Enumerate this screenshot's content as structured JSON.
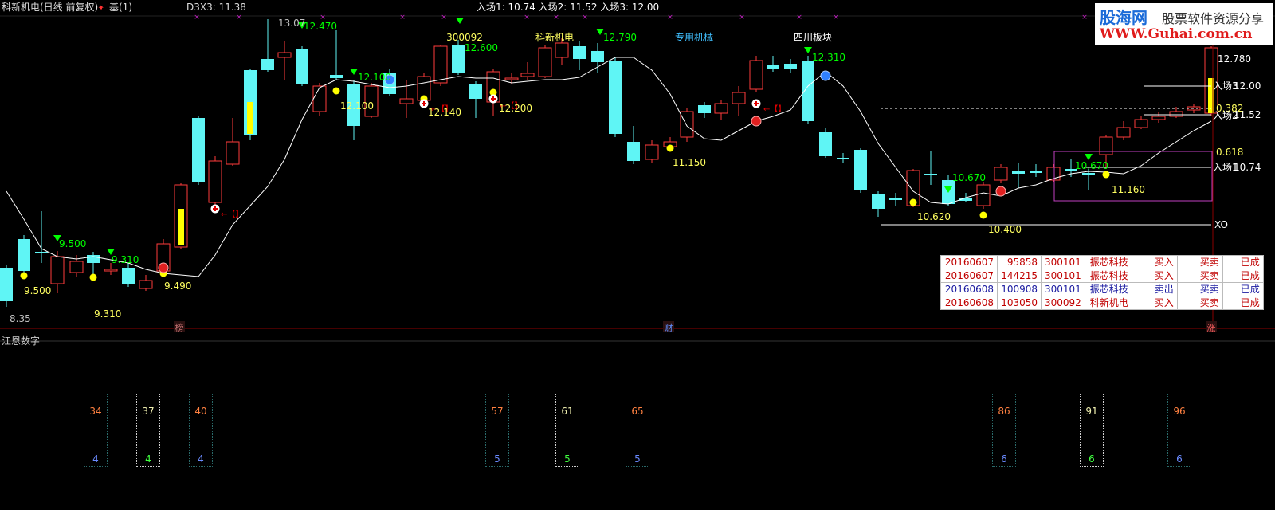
{
  "header": {
    "stock_title": "科新机电(日线 前复权)",
    "base_label": "基(1)",
    "indicator": "D3X3: 11.38",
    "entries": "入场1: 10.74  入场2: 11.52  入场3: 12.00"
  },
  "watermark": {
    "brand": "股海网",
    "slogan": "股票软件资源分享",
    "url": "WWW.Guhai.com.cn"
  },
  "colors": {
    "up": "#ff3b3b",
    "down": "#5ff5f5",
    "yellow": "#ffff00",
    "ma": "#ffffff",
    "magenta": "#c040c0",
    "green": "#00ff00"
  },
  "annotations": {
    "concepts": [
      "300092",
      "科新机电",
      "专用机械",
      "四川板块"
    ],
    "price_labels": [
      "13.07",
      "12.470",
      "12.600",
      "12.790",
      "12.310",
      "12.100",
      "12.100",
      "12.140",
      "12.200",
      "11.150",
      "9.500",
      "9.500",
      "9.310",
      "9.310",
      "9.490",
      "8.35",
      "10.670",
      "10.670",
      "10.620",
      "10.400",
      "11.160"
    ],
    "right_axis": [
      "12.780",
      "12.00",
      "11.52",
      "10.74"
    ],
    "fib_labels": [
      "0.382",
      "0.618"
    ],
    "entry_labels": [
      "入场3",
      "入场2",
      "入场1"
    ],
    "xo_label": "XO",
    "bottom_markers": [
      "榜",
      "财",
      "涨"
    ]
  },
  "trades": {
    "rows": [
      {
        "date": "20160607",
        "time": "95858",
        "code": "300101",
        "name": "振芯科技",
        "action": "买入",
        "type": "买卖",
        "status": "已成",
        "color": "#c00000"
      },
      {
        "date": "20160607",
        "time": "144215",
        "code": "300101",
        "name": "振芯科技",
        "action": "买入",
        "type": "买卖",
        "status": "已成",
        "color": "#c00000"
      },
      {
        "date": "20160608",
        "time": "100908",
        "code": "300101",
        "name": "振芯科技",
        "action": "卖出",
        "type": "买卖",
        "status": "已成",
        "color": "#1a1aa0"
      },
      {
        "date": "20160608",
        "time": "103050",
        "code": "300092",
        "name": "科新机电",
        "action": "买入",
        "type": "买卖",
        "status": "已成",
        "color": "#c00000"
      }
    ]
  },
  "subchart": {
    "title": "江恩数字",
    "boxes": [
      {
        "top": "34",
        "bottom": "4",
        "hl": false
      },
      {
        "top": "37",
        "bottom": "4",
        "hl": true
      },
      {
        "top": "40",
        "bottom": "4",
        "hl": false
      },
      {
        "top": "57",
        "bottom": "5",
        "hl": false
      },
      {
        "top": "61",
        "bottom": "5",
        "hl": true
      },
      {
        "top": "65",
        "bottom": "5",
        "hl": false
      },
      {
        "top": "86",
        "bottom": "6",
        "hl": false
      },
      {
        "top": "91",
        "bottom": "6",
        "hl": true
      },
      {
        "top": "96",
        "bottom": "6",
        "hl": false
      }
    ]
  }
}
